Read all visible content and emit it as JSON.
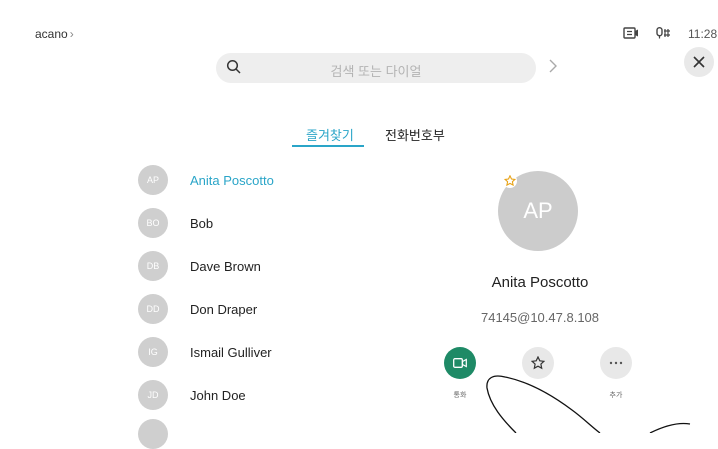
{
  "topbar": {
    "brand": "acano",
    "brand_chevron": "›",
    "time": "11:28",
    "icons": [
      "screen-share-icon",
      "mic-icon"
    ]
  },
  "search": {
    "placeholder": "검색 또는 다이얼",
    "go_icon": "chevron-right-icon",
    "close_icon": "close-icon"
  },
  "tabs": [
    {
      "label": "즐겨찾기",
      "active": true
    },
    {
      "label": "전화번호부",
      "active": false
    }
  ],
  "contacts": [
    {
      "initials": "AP",
      "name": "Anita Poscotto",
      "selected": true
    },
    {
      "initials": "BO",
      "name": "Bob"
    },
    {
      "initials": "DB",
      "name": "Dave Brown"
    },
    {
      "initials": "DD",
      "name": "Don Draper"
    },
    {
      "initials": "IG",
      "name": "Ismail Gulliver"
    },
    {
      "initials": "JD",
      "name": "John Doe"
    }
  ],
  "detail": {
    "initials": "AP",
    "name": "Anita Poscotto",
    "address": "74145@10.47.8.108",
    "favorite": true
  },
  "actions": [
    {
      "id": "call",
      "icon": "video-camera-icon",
      "label": "통화",
      "color": "#1e8a66"
    },
    {
      "id": "favorite",
      "icon": "star-icon",
      "label": ""
    },
    {
      "id": "more",
      "icon": "more-icon",
      "label": "추가"
    }
  ],
  "colors": {
    "accent": "#2aa5c8",
    "call": "#1e8a66",
    "avatar": "#cfcfcf"
  }
}
